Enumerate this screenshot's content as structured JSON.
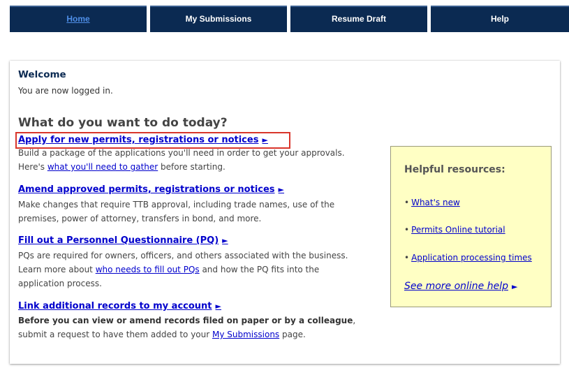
{
  "nav": {
    "tabs": [
      {
        "label": "Home",
        "active": true
      },
      {
        "label": "My Submissions",
        "active": false
      },
      {
        "label": "Resume Draft",
        "active": false
      },
      {
        "label": "Help",
        "active": false
      }
    ]
  },
  "welcome": {
    "title": "Welcome",
    "message": "You are now logged in."
  },
  "main": {
    "question": "What do you want to do today?",
    "arrow_glyph": "►",
    "actions": [
      {
        "link": "Apply for new permits, registrations or notices",
        "line1": "Build a package of the applications you'll need in order to get your approvals.",
        "line2_pre": "Here's ",
        "line2_link": "what you'll need to gather",
        "line2_post": " before starting."
      },
      {
        "link": "Amend approved permits, registrations or notices",
        "line1": "Make changes that require TTB approval, including trade names, use of the",
        "line2": "premises, power of attorney, transfers in bond, and more."
      },
      {
        "link": "Fill out a Personnel Questionnaire (PQ)",
        "line1": "PQs are required for owners, officers, and others associated with the business.",
        "line2_pre": "Learn more about ",
        "line2_link": "who needs to fill out PQs",
        "line2_post": " and how the PQ fits into the",
        "line3": "application process."
      },
      {
        "link": "Link additional records to my account",
        "line1_bold": "Before you can view or amend records filed on paper or by a colleague",
        "line1_post": ",",
        "line2_pre": "submit a request to have them added to your ",
        "line2_link": "My Submissions",
        "line2_post": " page."
      }
    ]
  },
  "resources": {
    "title": "Helpful resources:",
    "bullet": "•",
    "items": [
      "What's new",
      "Permits Online tutorial",
      "Application processing times"
    ],
    "more": "See more online help",
    "background": "#ffffc4"
  },
  "colors": {
    "nav_bg": "#0b2a52",
    "link": "#0000cc",
    "highlight": "#d9352b"
  }
}
